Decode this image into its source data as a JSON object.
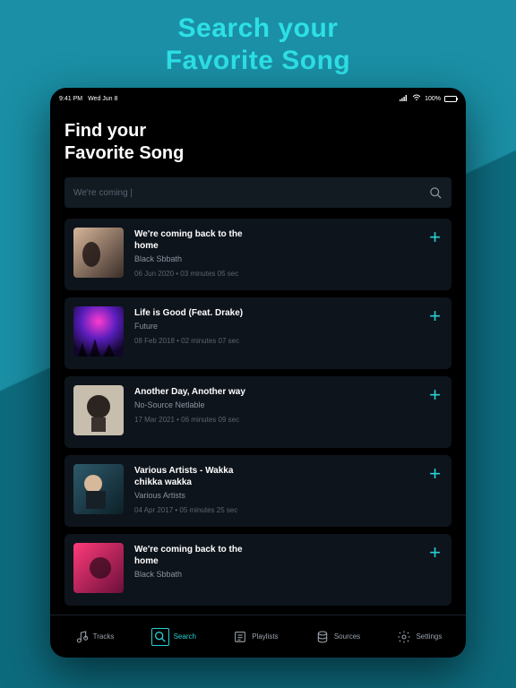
{
  "hero": {
    "line1": "Search your",
    "line2": "Favorite Song"
  },
  "statusbar": {
    "time": "9:41 PM",
    "date": "Wed Jun 8",
    "battery": "100%"
  },
  "page": {
    "title_line1": "Find your",
    "title_line2": "Favorite Song"
  },
  "search": {
    "value": "We're coming |"
  },
  "results": [
    {
      "title": "We're coming back to the home",
      "artist": "Black Sbbath",
      "date": "06 Jun 2020",
      "duration": "03 minutes 05 sec"
    },
    {
      "title": "Life is Good (Feat. Drake)",
      "artist": "Future",
      "date": "08 Feb 2018",
      "duration": "02 minutes 07 sec"
    },
    {
      "title": "Another Day, Another way",
      "artist": "No-Source Netlable",
      "date": "17 Mar 2021",
      "duration": "06 minutes 09 sec"
    },
    {
      "title": "Various Artists - Wakka chikka wakka",
      "artist": "Various Artists",
      "date": "04 Apr 2017",
      "duration": "05 minutes 25 sec"
    },
    {
      "title": "We're coming back to the home",
      "artist": "Black Sbbath",
      "date": "",
      "duration": ""
    }
  ],
  "tabs": {
    "tracks": "Tracks",
    "search": "Search",
    "playlists": "Playlists",
    "sources": "Sources",
    "settings": "Settings"
  },
  "colors": {
    "accent": "#27d0d6"
  }
}
